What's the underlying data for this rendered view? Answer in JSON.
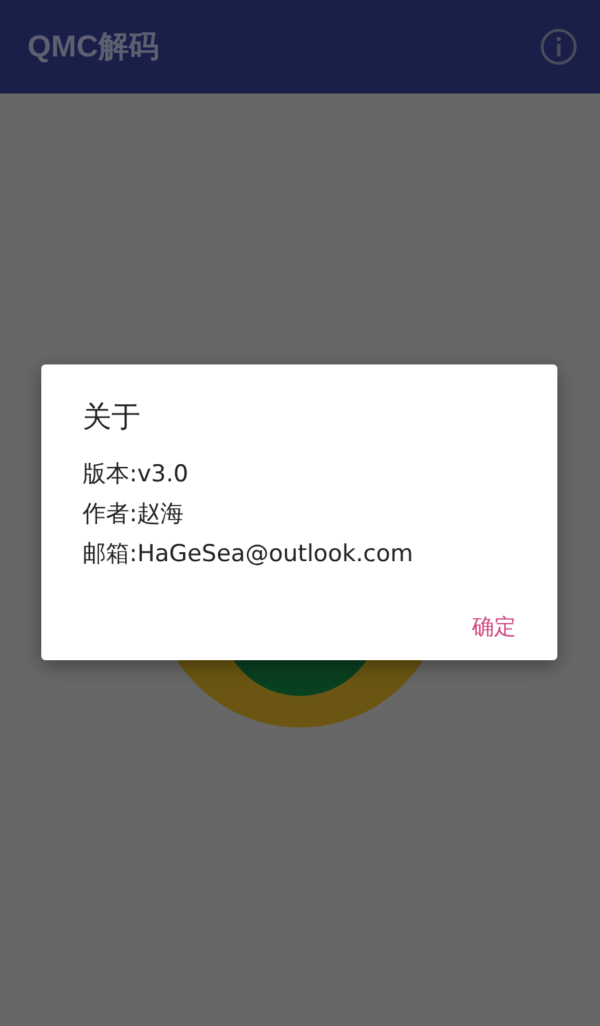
{
  "app_bar": {
    "title": "QMC解码"
  },
  "dialog": {
    "title": "关于",
    "lines": [
      "版本:v3.0",
      "作者:赵海",
      "邮箱:HaGeSea@outlook.com"
    ],
    "buttons": [
      "确定"
    ]
  }
}
